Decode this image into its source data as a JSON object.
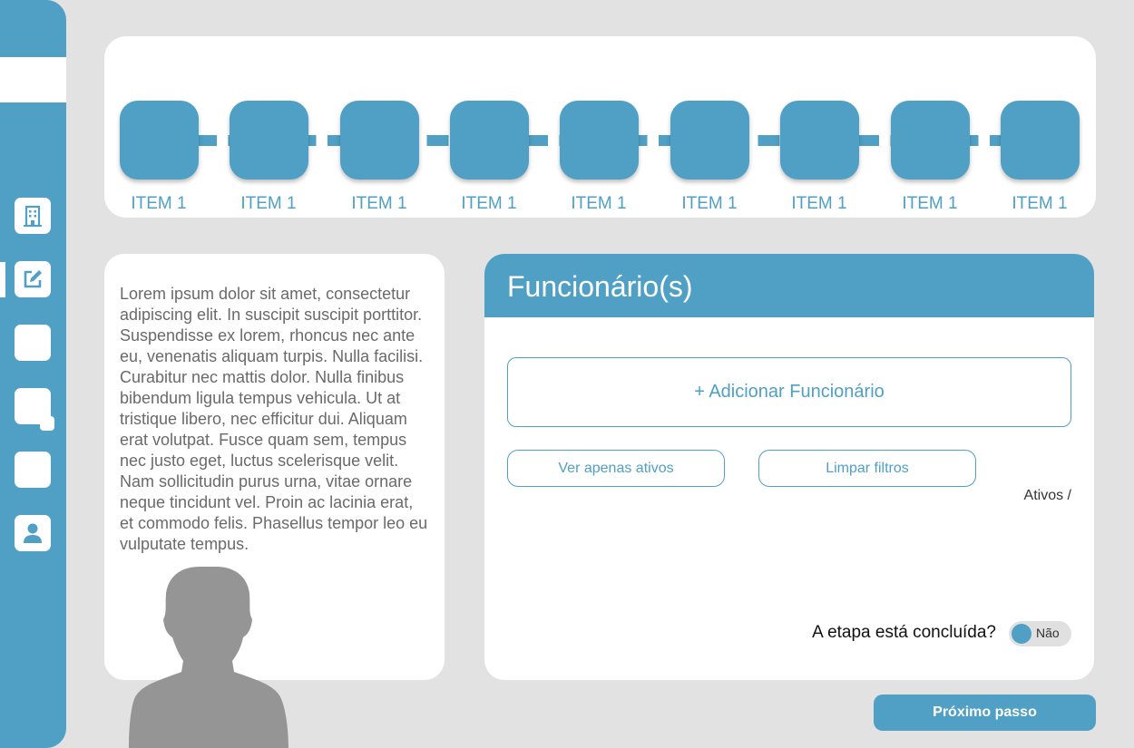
{
  "stepper": {
    "steps": [
      {
        "label": "ITEM 1"
      },
      {
        "label": "ITEM 1"
      },
      {
        "label": "ITEM 1"
      },
      {
        "label": "ITEM 1"
      },
      {
        "label": "ITEM 1"
      },
      {
        "label": "ITEM 1"
      },
      {
        "label": "ITEM 1"
      },
      {
        "label": "ITEM 1"
      },
      {
        "label": "ITEM 1"
      }
    ]
  },
  "sidebar": {
    "icons": [
      "building-icon",
      "edit-icon",
      "blank-icon",
      "blank-icon",
      "blank-icon",
      "user-icon"
    ],
    "active": "edit-icon"
  },
  "info": {
    "text": "Lorem ipsum dolor sit amet, consectetur adipiscing elit. In suscipit suscipit porttitor. Suspendisse ex lorem, rhoncus nec ante eu, venenatis aliquam turpis. Nulla facilisi. Curabitur nec mattis dolor. Nulla finibus bibendum ligula tempus vehicula. Ut at tristique libero, nec efficitur dui. Aliquam erat volutpat. Fusce quam sem, tempus nec justo eget, luctus scelerisque velit. Nam sollicitudin purus urna, vitae ornare neque tincidunt vel. Proin ac lacinia erat, et commodo felis. Phasellus tempor leo eu vulputate tempus."
  },
  "employees": {
    "title": "Funcionário(s)",
    "add_label": "+ Adicionar Funcionário",
    "filter_active_label": "Ver apenas ativos",
    "clear_filters_label": "Limpar filtros",
    "ativos_label": "Ativos /",
    "done_question": "A etapa está concluída?",
    "done_value": "Não"
  },
  "footer": {
    "next_label": "Próximo passo"
  },
  "colors": {
    "accent": "#4fa0c4",
    "background": "#e2e2e2",
    "card": "#ffffff"
  }
}
